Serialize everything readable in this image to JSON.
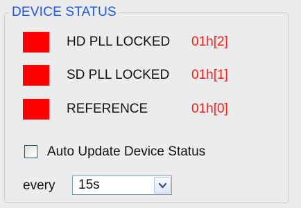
{
  "group": {
    "title": "DEVICE STATUS"
  },
  "status": [
    {
      "label": "HD PLL LOCKED",
      "register": "01h[2]",
      "led_color": "#ff0000"
    },
    {
      "label": "SD PLL LOCKED",
      "register": "01h[1]",
      "led_color": "#ff0000"
    },
    {
      "label": "REFERENCE",
      "register": "01h[0]",
      "led_color": "#ff0000"
    }
  ],
  "auto_update": {
    "label": "Auto Update Device Status",
    "checked": false
  },
  "interval": {
    "prefix": "every",
    "value": "15s"
  },
  "icons": {
    "dropdown": "chevron-down-icon"
  },
  "colors": {
    "title": "#1a55ff",
    "register": "#ff1a1a",
    "led": "#ff0000"
  }
}
